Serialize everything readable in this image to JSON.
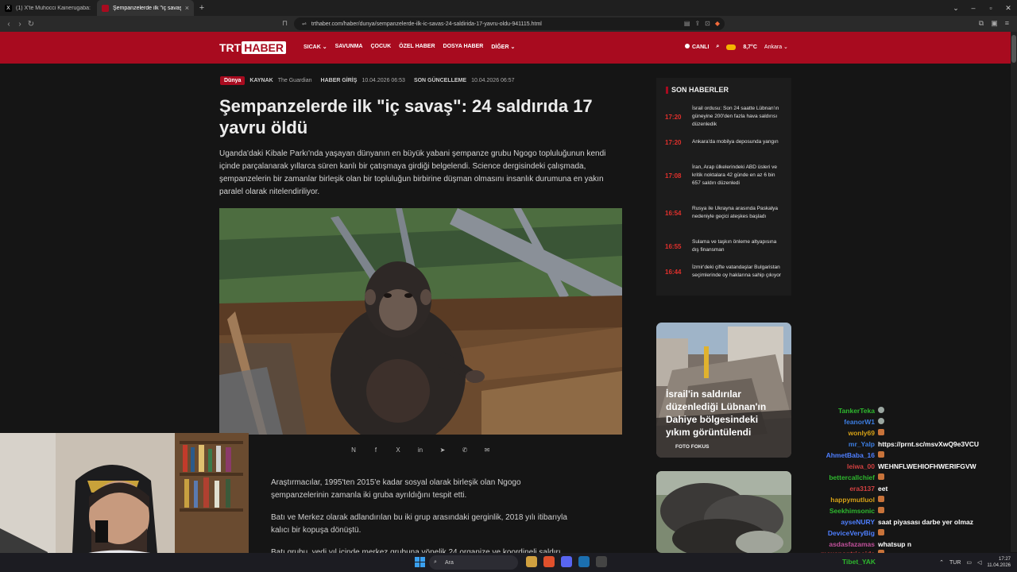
{
  "browser": {
    "tabs": [
      {
        "label": "(1) X'te Muhocci Kainerugaba: \"For t",
        "active": false
      },
      {
        "label": "Şempanzelerde ilk \"iç savaş\": 24",
        "active": true
      }
    ],
    "url": "trthaber.com/haber/dunya/sempanzelerde-ilk-ic-savas-24-saldirida-17-yavru-oldu-941115.html"
  },
  "site": {
    "logo_trt": "TRT",
    "logo_haber": "HABER",
    "menu": [
      "SICAK ⌄",
      "SAVUNMA",
      "ÇOCUK",
      "ÖZEL HABER",
      "DOSYA HABER",
      "DİĞER ⌄"
    ],
    "live": "CANLI",
    "weather": "8,7°C",
    "city": "Ankara ⌄"
  },
  "article": {
    "category": "Dünya",
    "source_label": "KAYNAK",
    "source": "The Guardian",
    "entry_label": "HABER GİRİŞ",
    "entry_date": "10.04.2026 06:53",
    "update_label": "SON GÜNCELLEME",
    "update_date": "10.04.2026 06:57",
    "title": "Şempanzelerde ilk \"iç savaş\": 24 saldırıda 17 yavru öldü",
    "lead": "Uganda'daki Kibale Parkı'nda yaşayan dünyanın en büyük yabani şempanze grubu Ngogo topluluğunun kendi içinde parçalanarak yıllarca süren kanlı bir çatışmaya girdiği belgelendi. Science dergisindeki çalışmada, şempanzelerin bir zamanlar birleşik olan bir topluluğun birbirine düşman olmasını insanlık durumuna en yakın paralel olarak nitelendiriliyor.",
    "share": [
      "N",
      "f",
      "X",
      "in",
      "➤",
      "✆",
      "✉"
    ],
    "paragraphs": [
      "Araştırmacılar, 1995'ten 2015'e kadar sosyal olarak birleşik olan Ngogo şempanzelerinin zamanla iki gruba ayrıldığını tespit etti.",
      "Batı ve Merkez olarak adlandırılan bu iki grup arasındaki gerginlik, 2018 yılı itibarıyla kalıcı bir kopuşa dönüştü.",
      "Batı grubu, yedi yıl içinde merkez grubuna yönelik 24 organize ve koordineli saldırı"
    ]
  },
  "sidebar": {
    "heading": "SON HABERLER",
    "news": [
      {
        "time": "17:20",
        "text": "İsrail ordusu: Son 24 saatte Lübnan'ın güneyine 200'den fazla hava saldırısı düzenledik"
      },
      {
        "time": "17:20",
        "text": "Ankara'da mobilya deposunda yangın"
      },
      {
        "time": "17:08",
        "text": "İran, Arap ülkelerindeki ABD üsleri ve kritik noktalara 42 günde en az 6 bin 657 saldırı düzenledi"
      },
      {
        "time": "16:54",
        "text": "Rusya ile Ukrayna arasında Paskalya nedeniyle geçici ateşkes başladı"
      },
      {
        "time": "16:55",
        "text": "Sulama ve taşkın önleme altyapısına dış finansman"
      },
      {
        "time": "16:44",
        "text": "İzmir'deki çifte vatandaşlar Bulgaristan seçimlerinde oy haklarına sahip çıkıyor"
      }
    ],
    "card1_title": "İsrail'in saldırılar düzenlediği Lübnan'ın Dahiye bölgesindeki yıkım görüntülendi",
    "card1_cat": "FOTO FOKUS"
  },
  "chat": [
    {
      "name": "TankerTeka",
      "color": "#2eb82e",
      "msg": "",
      "emote": "g"
    },
    {
      "name": "feanorW1",
      "color": "#3c7de0",
      "msg": "",
      "emote": "g"
    },
    {
      "name": "wonly69",
      "color": "#d4a017",
      "msg": "",
      "emote": "o"
    },
    {
      "name": "mr_Yalp",
      "color": "#3c7de0",
      "msg": "https://prnt.sc/msvXwQ9e3VCU",
      "emote": ""
    },
    {
      "name": "AhmetBaba_16",
      "color": "#4e7fff",
      "msg": "",
      "emote": "o"
    },
    {
      "name": "leiwa_00",
      "color": "#d04040",
      "msg": "WEHNFLWEHIOFHWERIFGVW",
      "emote": ""
    },
    {
      "name": "bettercallchief",
      "color": "#2eb82e",
      "msg": "",
      "emote": "o"
    },
    {
      "name": "era3137",
      "color": "#d04040",
      "msg": "eet",
      "emote": ""
    },
    {
      "name": "happymutluol",
      "color": "#d4a017",
      "msg": "",
      "emote": "o"
    },
    {
      "name": "Seekhimsonic",
      "color": "#2eb82e",
      "msg": "",
      "emote": "o"
    },
    {
      "name": "ayseNURY",
      "color": "#4e7fff",
      "msg": "saat piyasası darbe yer olmaz",
      "emote": ""
    },
    {
      "name": "DeviceVeryBig",
      "color": "#4e7fff",
      "msg": "",
      "emote": "o"
    },
    {
      "name": "asdasfazamas",
      "color": "#c0509a",
      "msg": "whatsup n",
      "emote": ""
    },
    {
      "name": "maxenontrioaide",
      "color": "#d04040",
      "msg": "",
      "emote": "o"
    },
    {
      "name": "Tibet_YAK",
      "color": "#2eb82e",
      "msg": "",
      "emote": "o"
    }
  ],
  "taskbar": {
    "search": "Ara",
    "lang": "TUR",
    "time": "17:27",
    "date": "11.04.2026"
  }
}
